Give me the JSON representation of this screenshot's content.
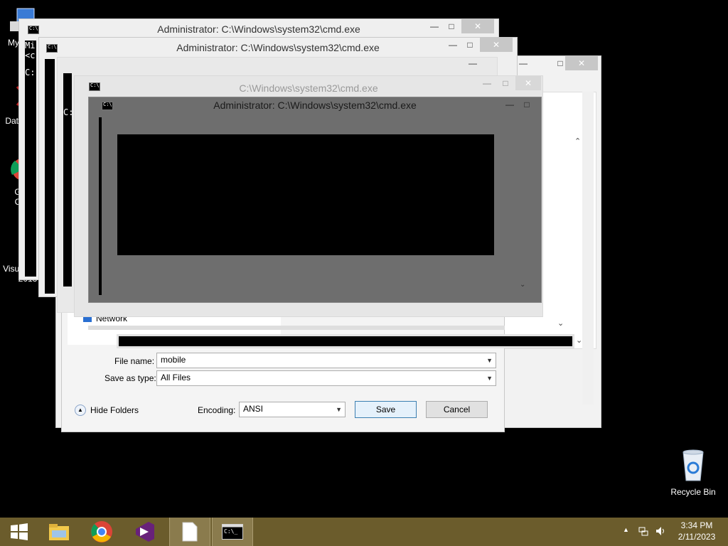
{
  "desktop": {
    "icons": [
      {
        "label": "My C..."
      },
      {
        "label": "Data... n..."
      },
      {
        "label": "G\nC"
      },
      {
        "label": "Visual Studio 2013"
      },
      {
        "label": "Recycle Bin"
      }
    ]
  },
  "windows": {
    "cmd_1_title": "Administrator: C:\\Windows\\system32\\cmd.exe",
    "cmd_2_title": "Administrator: C:\\Windows\\system32\\cmd.exe",
    "cmd_3_title": "C:\\Windows\\system32\\cmd.exe",
    "cmd_4_title": "Administrator: C:\\Windows\\system32\\cmd.exe",
    "console_line_1": "Mi",
    "console_line_2": "<c",
    "console_line_3": "C:",
    "minimize_glyph": "—",
    "maximize_glyph": "□",
    "close_glyph": "✕"
  },
  "save_dialog": {
    "nav_item": "Network",
    "file_name_label": "File name:",
    "file_name_value": "mobile",
    "save_as_type_label": "Save as type:",
    "save_as_type_value": "All Files",
    "encoding_label": "Encoding:",
    "encoding_value": "ANSI",
    "save_button": "Save",
    "cancel_button": "Cancel",
    "hide_folders": "Hide Folders"
  },
  "taskbar": {
    "clock_time": "3:34 PM",
    "clock_date": "2/11/2023",
    "items": [
      "start",
      "file-explorer",
      "chrome",
      "visual-studio",
      "notepad",
      "cmd"
    ]
  }
}
